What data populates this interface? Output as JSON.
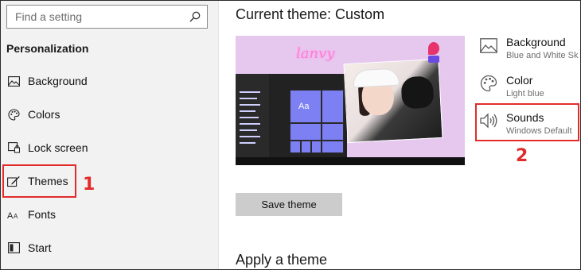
{
  "sidebar": {
    "search_placeholder": "Find a setting",
    "section_title": "Personalization",
    "items": [
      {
        "label": "Background",
        "icon": "image-icon"
      },
      {
        "label": "Colors",
        "icon": "palette-icon"
      },
      {
        "label": "Lock screen",
        "icon": "lock-screen-icon"
      },
      {
        "label": "Themes",
        "icon": "brush-icon"
      },
      {
        "label": "Fonts",
        "icon": "font-icon"
      },
      {
        "label": "Start",
        "icon": "start-icon"
      }
    ]
  },
  "main": {
    "title": "Current theme: Custom",
    "preview": {
      "tile_label": "Aa",
      "neon_text": "lanvy"
    },
    "options": [
      {
        "title": "Background",
        "subtitle": "Blue and White Sk",
        "icon": "image-icon"
      },
      {
        "title": "Color",
        "subtitle": "Light blue",
        "icon": "palette-icon"
      },
      {
        "title": "Sounds",
        "subtitle": "Windows Default",
        "icon": "speaker-icon"
      }
    ],
    "save_button": "Save theme",
    "apply_title": "Apply a theme"
  },
  "annotations": {
    "marker_1": "1",
    "marker_2": "2",
    "color": "#e22b2b"
  }
}
